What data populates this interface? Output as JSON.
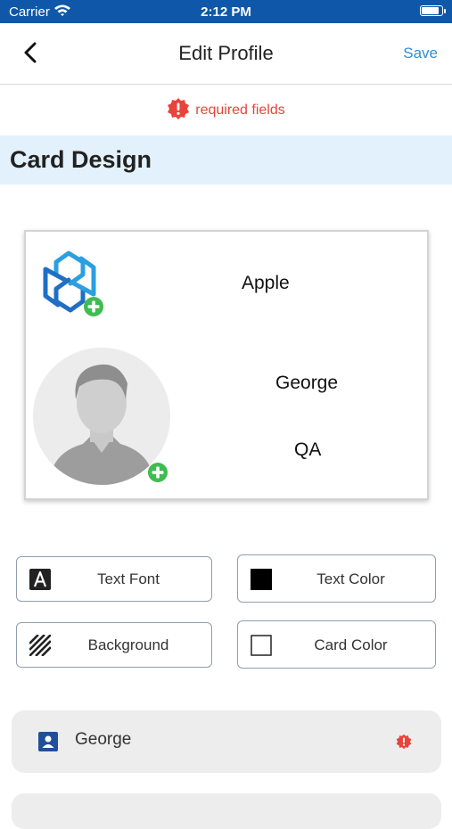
{
  "status_bar": {
    "carrier": "Carrier",
    "time": "2:12 PM"
  },
  "nav": {
    "title": "Edit Profile",
    "save_label": "Save"
  },
  "required_notice": "required fields",
  "section_title": "Card Design",
  "card": {
    "company": "Apple",
    "name": "George",
    "role": "QA"
  },
  "options": {
    "text_font": "Text Font",
    "text_color": "Text Color",
    "background": "Background",
    "card_color": "Card Color"
  },
  "fields": {
    "name_value": "George"
  },
  "colors": {
    "status_bar": "#0f57a8",
    "accent": "#2f8fd6",
    "required": "#e8443a",
    "section_bg": "#e3f1fc",
    "add_green": "#3dbd4f",
    "field_bg": "#ededed",
    "name_icon": "#1f4f99"
  },
  "icons": {
    "back": "chevron-left-icon",
    "required": "required-alert-icon",
    "logo": "company-logo",
    "add": "plus-circle-icon",
    "avatar": "person-avatar",
    "text_font": "letter-a-icon",
    "text_color": "black-square-icon",
    "background": "hatch-pattern-icon",
    "card_color": "empty-square-icon",
    "name_field": "contact-card-icon"
  }
}
